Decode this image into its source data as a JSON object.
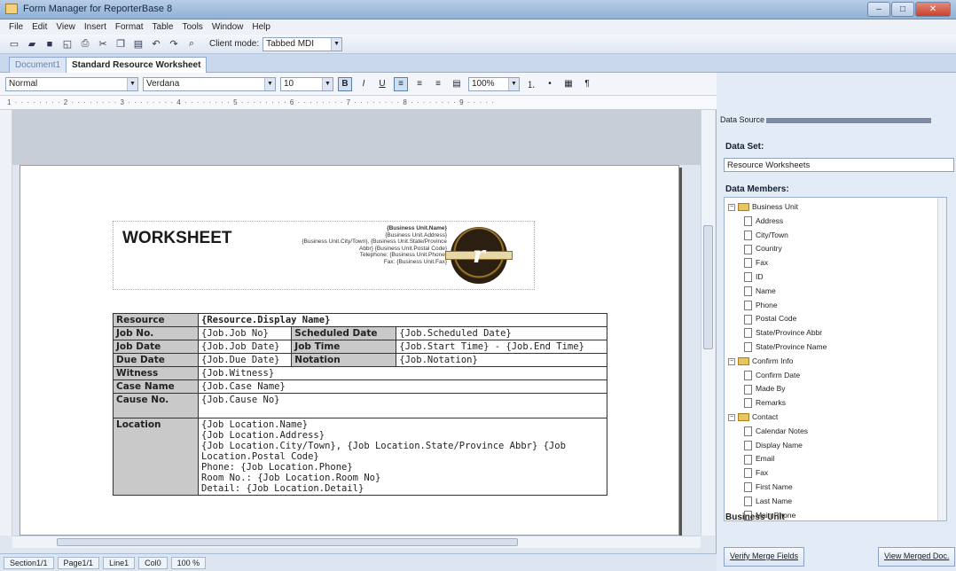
{
  "window": {
    "title": "Form Manager for ReporterBase 8"
  },
  "menu": [
    "File",
    "Edit",
    "View",
    "Insert",
    "Format",
    "Table",
    "Tools",
    "Window",
    "Help"
  ],
  "toolbar": {
    "client_mode_label": "Client mode:",
    "client_mode_value": "Tabbed MDI"
  },
  "tabs": [
    {
      "label": "Document1"
    },
    {
      "label": "Standard Resource Worksheet"
    }
  ],
  "format": {
    "style": "Normal",
    "font": "Verdana",
    "size": "10",
    "zoom": "100%"
  },
  "ruler": "1 · · · · · · · · 2 · · · · · · · · 3 · · · · · · · · 4 · · · · · · · · 5 · · · · · · · · 6 · · · · · · · · 7 · · · · · · · · 8 · · · · · · · · 9 · · · · ·",
  "document": {
    "header_title": "WORKSHEET",
    "address_lines": [
      "{Business Unit.Name}",
      "{Business Unit.Address}",
      "{Business Unit.City/Town}, {Business Unit.State/Province",
      "Abbr} {Business Unit.Postal Code}",
      "Telephone: {Business Unit.Phone}",
      "Fax: {Business Unit.Fax}"
    ],
    "logo_letter": "r",
    "rows": {
      "resource": {
        "label": "Resource",
        "value": "{Resource.Display Name}"
      },
      "job_no": {
        "label": "Job No.",
        "value": "{Job.Job No}"
      },
      "scheduled_date": {
        "label": "Scheduled Date",
        "value": "{Job.Scheduled Date}"
      },
      "job_date": {
        "label": "Job Date",
        "value": "{Job.Job Date}"
      },
      "job_time": {
        "label": "Job Time",
        "value": "{Job.Start Time} - {Job.End Time}"
      },
      "due_date": {
        "label": "Due Date",
        "value": "{Job.Due Date}"
      },
      "notation": {
        "label": "Notation",
        "value": "{Job.Notation}"
      },
      "witness": {
        "label": "Witness",
        "value": "{Job.Witness}"
      },
      "case_name": {
        "label": "Case Name",
        "value": "{Job.Case Name}"
      },
      "cause_no": {
        "label": "Cause No.",
        "value": "{Job.Cause No}"
      },
      "location": {
        "label": "Location",
        "lines": [
          "{Job Location.Name}",
          "{Job Location.Address}",
          "{Job Location.City/Town}, {Job Location.State/Province Abbr} {Job",
          "Location.Postal Code}",
          "Phone: {Job Location.Phone}",
          "Room No.: {Job Location.Room No}",
          "Detail: {Job Location.Detail}"
        ]
      }
    }
  },
  "status": {
    "section": "Section1/1",
    "page": "Page1/1",
    "line": "Line1",
    "col": "Col0",
    "zoom": "100 %"
  },
  "datasource": {
    "title": "Data Source",
    "dataset_label": "Data Set:",
    "dataset_value": "Resource Worksheets",
    "members_label": "Data Members:",
    "tree": [
      {
        "type": "folder",
        "label": "Business Unit",
        "level": 0
      },
      {
        "type": "field",
        "label": "Address",
        "level": 1
      },
      {
        "type": "field",
        "label": "City/Town",
        "level": 1
      },
      {
        "type": "field",
        "label": "Country",
        "level": 1
      },
      {
        "type": "field",
        "label": "Fax",
        "level": 1
      },
      {
        "type": "field",
        "label": "ID",
        "level": 1
      },
      {
        "type": "field",
        "label": "Name",
        "level": 1
      },
      {
        "type": "field",
        "label": "Phone",
        "level": 1
      },
      {
        "type": "field",
        "label": "Postal Code",
        "level": 1
      },
      {
        "type": "field",
        "label": "State/Province Abbr",
        "level": 1
      },
      {
        "type": "field",
        "label": "State/Province Name",
        "level": 1
      },
      {
        "type": "folder",
        "label": "Confirm Info",
        "level": 0
      },
      {
        "type": "field",
        "label": "Confirm Date",
        "level": 1
      },
      {
        "type": "field",
        "label": "Made By",
        "level": 1
      },
      {
        "type": "field",
        "label": "Remarks",
        "level": 1
      },
      {
        "type": "folder",
        "label": "Contact",
        "level": 0
      },
      {
        "type": "field",
        "label": "Calendar Notes",
        "level": 1
      },
      {
        "type": "field",
        "label": "Display Name",
        "level": 1
      },
      {
        "type": "field",
        "label": "Email",
        "level": 1
      },
      {
        "type": "field",
        "label": "Fax",
        "level": 1
      },
      {
        "type": "field",
        "label": "First Name",
        "level": 1
      },
      {
        "type": "field",
        "label": "Last Name",
        "level": 1
      },
      {
        "type": "field",
        "label": "Main Phone",
        "level": 1
      }
    ],
    "selected_node": "Business Unit",
    "verify_button": "Verify Merge Fields",
    "view_button": "View Merged Doc."
  }
}
